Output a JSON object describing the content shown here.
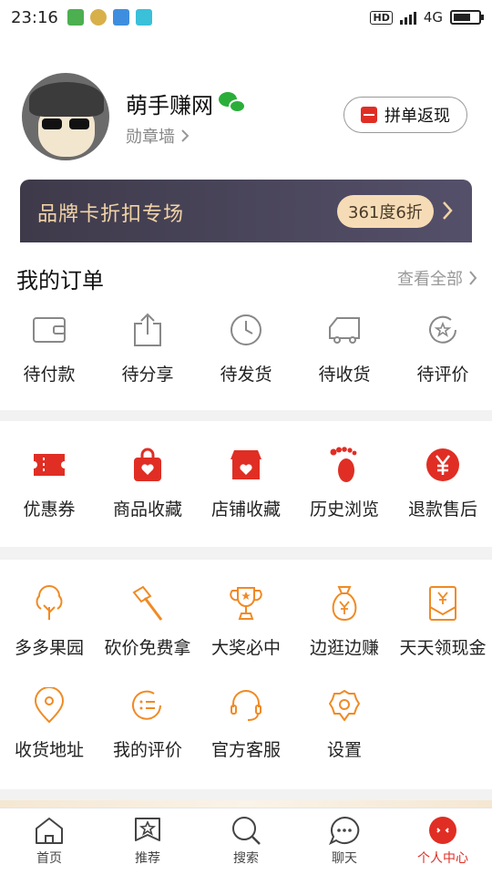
{
  "status_bar": {
    "time": "23:16",
    "network": "4G",
    "hd": "HD"
  },
  "profile": {
    "nickname": "萌手赚网",
    "badge_wall": "勋章墙",
    "group_button": "拼单返现"
  },
  "brand_card": {
    "title": "品牌卡折扣专场",
    "offer": "361度6折"
  },
  "orders": {
    "title": "我的订单",
    "view_all": "查看全部",
    "items": [
      {
        "label": "待付款",
        "icon": "wallet-icon"
      },
      {
        "label": "待分享",
        "icon": "share-icon"
      },
      {
        "label": "待发货",
        "icon": "clock-icon"
      },
      {
        "label": "待收货",
        "icon": "truck-icon"
      },
      {
        "label": "待评价",
        "icon": "star-review-icon"
      }
    ]
  },
  "favorites": {
    "items": [
      {
        "label": "优惠券",
        "icon": "coupon-icon"
      },
      {
        "label": "商品收藏",
        "icon": "bag-heart-icon"
      },
      {
        "label": "店铺收藏",
        "icon": "store-heart-icon"
      },
      {
        "label": "历史浏览",
        "icon": "footprint-icon"
      },
      {
        "label": "退款售后",
        "icon": "refund-yen-icon"
      }
    ]
  },
  "tools": {
    "row1": [
      {
        "label": "多多果园",
        "icon": "tree-icon"
      },
      {
        "label": "砍价免费拿",
        "icon": "axe-icon"
      },
      {
        "label": "大奖必中",
        "icon": "trophy-icon"
      },
      {
        "label": "边逛边赚",
        "icon": "money-bag-icon"
      },
      {
        "label": "天天领现金",
        "icon": "cash-envelope-icon"
      }
    ],
    "row2": [
      {
        "label": "收货地址",
        "icon": "location-icon"
      },
      {
        "label": "我的评价",
        "icon": "comment-list-icon"
      },
      {
        "label": "官方客服",
        "icon": "headset-icon"
      },
      {
        "label": "设置",
        "icon": "settings-icon"
      }
    ]
  },
  "tab_bar": {
    "tabs": [
      {
        "label": "首页",
        "icon": "home-icon"
      },
      {
        "label": "推荐",
        "icon": "recommend-icon"
      },
      {
        "label": "搜索",
        "icon": "search-icon"
      },
      {
        "label": "聊天",
        "icon": "chat-icon"
      },
      {
        "label": "个人中心",
        "icon": "profile-icon"
      }
    ],
    "active_index": 4
  },
  "colors": {
    "accent": "#e02e24",
    "tool_icon": "#f08a24",
    "brand_gold": "#f1d3a6"
  }
}
